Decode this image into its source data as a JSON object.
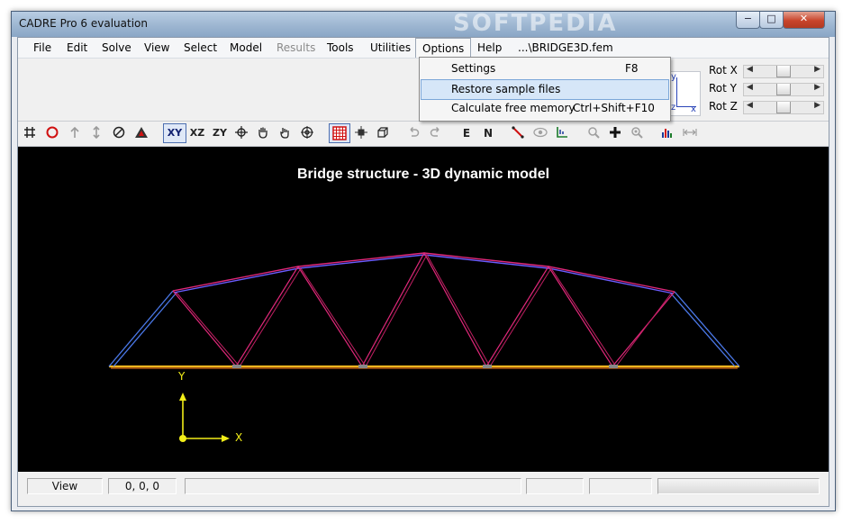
{
  "window": {
    "title": "CADRE Pro 6 evaluation",
    "watermark": "SOFTPEDIA",
    "min_glyph": "−",
    "max_glyph": "□",
    "close_glyph": "✕"
  },
  "menubar": {
    "items": [
      "File",
      "Edit",
      "Solve",
      "View",
      "Select",
      "Model",
      "Results",
      "Tools",
      "Utilities",
      "Options",
      "Help"
    ],
    "file_path": "...\\BRIDGE3D.fem"
  },
  "options_menu": {
    "items": [
      {
        "label": "Settings",
        "shortcut": "F8"
      },
      {
        "label": "Restore sample files",
        "shortcut": ""
      },
      {
        "label": "Calculate free memory",
        "shortcut": "Ctrl+Shift+F10"
      }
    ]
  },
  "axis_preview": {
    "y": "y",
    "z": "z",
    "x": "x"
  },
  "rotation": {
    "x_label": "Rot X",
    "y_label": "Rot Y",
    "z_label": "Rot Z",
    "left_arrow": "◀",
    "right_arrow": "▶"
  },
  "toolbar": {
    "view_xy": "XY",
    "view_xz": "XZ",
    "view_zy": "ZY",
    "e_label": "E",
    "n_label": "N"
  },
  "canvas": {
    "title": "Bridge structure - 3D dynamic model",
    "axis_y": "Y",
    "axis_x": "X"
  },
  "status": {
    "mode": "View",
    "coords": "0, 0, 0"
  },
  "colors": {
    "chord_top": "#6b5cff",
    "web": "#e0287a",
    "deck": "#f2b51e",
    "end_post": "#4a78e8",
    "axis": "#f2ee18"
  }
}
